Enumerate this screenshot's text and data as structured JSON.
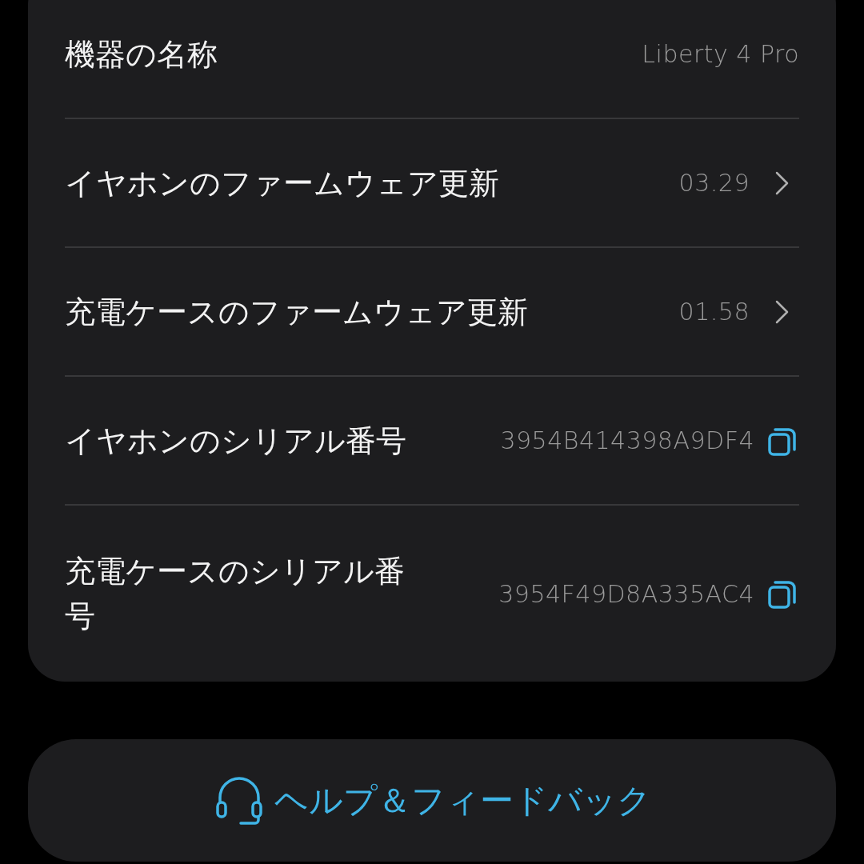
{
  "rows": [
    {
      "kind": "plain",
      "label": "機器の名称",
      "value": "Liberty 4 Pro"
    },
    {
      "kind": "chevron",
      "label": "イヤホンのファームウェア更新",
      "value": "03.29"
    },
    {
      "kind": "chevron",
      "label": "充電ケースのファームウェア更新",
      "value": "01.58"
    },
    {
      "kind": "copy",
      "label": "イヤホンのシリアル番号",
      "value": "3954B414398A9DF4"
    },
    {
      "kind": "copy",
      "label": "充電ケースのシリアル番号",
      "value": "3954F49D8A335AC4"
    }
  ],
  "help_button": {
    "label": "ヘルプ＆フィードバック"
  }
}
